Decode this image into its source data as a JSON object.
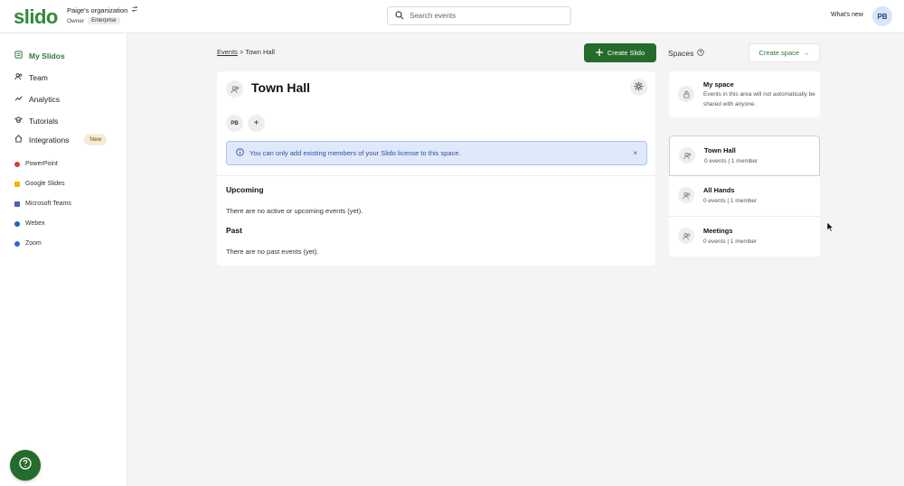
{
  "header": {
    "logo": "slido",
    "org_name": "Paige's organization",
    "role": "Owner",
    "plan_badge": "Enterprise",
    "search_placeholder": "Search events",
    "whats_new": "What's new",
    "avatar_initials": "PB"
  },
  "sidebar": {
    "items": [
      {
        "label": "My Slidos",
        "icon": "slides-icon"
      },
      {
        "label": "Team",
        "icon": "team-icon"
      },
      {
        "label": "Analytics",
        "icon": "analytics-icon"
      },
      {
        "label": "Tutorials",
        "icon": "tutorials-icon"
      },
      {
        "label": "Integrations",
        "icon": "integrations-icon",
        "badge": "New"
      }
    ],
    "integrations": [
      {
        "label": "PowerPoint",
        "color": "#c94a2c"
      },
      {
        "label": "Google Slides",
        "color": "#f2b400"
      },
      {
        "label": "Microsoft Teams",
        "color": "#5059c9"
      },
      {
        "label": "Webex",
        "color": "#1d5fd6"
      },
      {
        "label": "Zoom",
        "color": "#2d64e6"
      }
    ]
  },
  "breadcrumb": {
    "link": "Events",
    "separator": ">",
    "current": "Town Hall"
  },
  "create_slido_label": "Create Slido",
  "space": {
    "title": "Town Hall",
    "member_initials": "PB",
    "add_member": "+",
    "info_message": "You can only add existing members of your Slido license to this space.",
    "info_close": "×",
    "upcoming_heading": "Upcoming",
    "upcoming_text": "There are no active or upcoming events (yet).",
    "past_heading": "Past",
    "past_text": "There are no past events (yet)."
  },
  "spaces_panel": {
    "heading": "Spaces",
    "create_label": "Create space",
    "create_arrow": "→",
    "my_space": {
      "title": "My space",
      "desc": "Events in this area will not automatically be shared with anyone."
    },
    "list": [
      {
        "title": "Town Hall",
        "sub": "0 events | 1 member"
      },
      {
        "title": "All Hands",
        "sub": "0 events | 1 member"
      },
      {
        "title": "Meetings",
        "sub": "0 events | 1 member"
      }
    ]
  },
  "colors": {
    "brand_green": "#246b2c",
    "logo_green": "#2f8a3a",
    "info_blue": "#2d4fa0",
    "info_bg": "#dfe9fb"
  }
}
